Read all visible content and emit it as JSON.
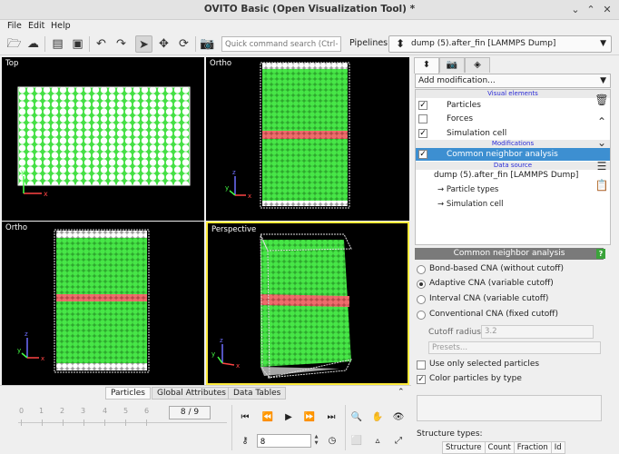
{
  "window": {
    "title": "OVITO Basic (Open Visualization Tool) *"
  },
  "menu": [
    "File",
    "Edit",
    "Help"
  ],
  "toolbar": {
    "search_placeholder": "Quick command search (Ctrl+P)",
    "pipelines_label": "Pipelines:",
    "pipeline_value": "dump (5).after_fin [LAMMPS Dump]"
  },
  "viewports": [
    {
      "label": "Top",
      "active": false
    },
    {
      "label": "Ortho",
      "active": false
    },
    {
      "label": "Ortho",
      "active": false
    },
    {
      "label": "Perspective",
      "active": true
    }
  ],
  "axes": {
    "x": "x",
    "y": "y",
    "z": "z"
  },
  "panel": {
    "add_modification": "Add modification...",
    "categories": {
      "visual": "Visual elements",
      "modifications": "Modifications",
      "data_source": "Data source"
    },
    "visual_elements": [
      {
        "label": "Particles",
        "checked": true
      },
      {
        "label": "Forces",
        "checked": false
      },
      {
        "label": "Simulation cell",
        "checked": true
      }
    ],
    "modification": {
      "label": "Common neighbor analysis",
      "checked": true
    },
    "data_source": {
      "label": "dump (5).after_fin [LAMMPS Dump]",
      "children": [
        "→ Particle types",
        "→ Simulation cell"
      ]
    }
  },
  "cna": {
    "header": "Common neighbor analysis",
    "help": "?",
    "modes": [
      {
        "label": "Bond-based CNA (without cutoff)",
        "selected": false
      },
      {
        "label": "Adaptive CNA (variable cutoff)",
        "selected": true
      },
      {
        "label": "Interval CNA (variable cutoff)",
        "selected": false
      },
      {
        "label": "Conventional CNA (fixed cutoff)",
        "selected": false
      }
    ],
    "cutoff_label": "Cutoff radius:",
    "cutoff_value": "3.2",
    "presets": "Presets...",
    "use_selected": {
      "label": "Use only selected particles",
      "checked": false
    },
    "color_by_type": {
      "label": "Color particles by type",
      "checked": true
    },
    "structure_types_label": "Structure types:",
    "table_headers": [
      "Structure",
      "Count",
      "Fraction",
      "Id"
    ]
  },
  "bottom": {
    "tabs": [
      "Particles",
      "Global Attributes",
      "Data Tables"
    ],
    "timeline_ticks": [
      "0",
      "1",
      "2",
      "3",
      "4",
      "5",
      "6"
    ],
    "frame_indicator": "8 / 9",
    "frame_value": "8"
  },
  "colors": {
    "particle": "#44e044",
    "interface": "#e06060",
    "surface": "#ffffff",
    "selection": "#3d8fd1",
    "active_border": "#ffeb3b"
  }
}
